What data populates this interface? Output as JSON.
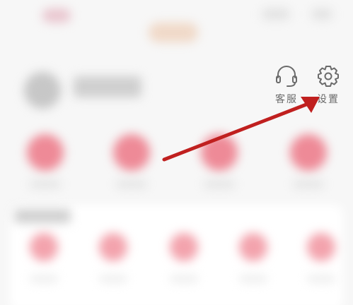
{
  "header": {
    "service_label": "客服",
    "settings_label": "设置"
  },
  "icons": {
    "service": "headset-icon",
    "settings": "gear-icon"
  },
  "annotation": {
    "arrow_color": "#c0201f",
    "points_to": "settings-button"
  },
  "colors": {
    "accent": "#ee8a97",
    "icon_gray": "#6b6b6b"
  }
}
